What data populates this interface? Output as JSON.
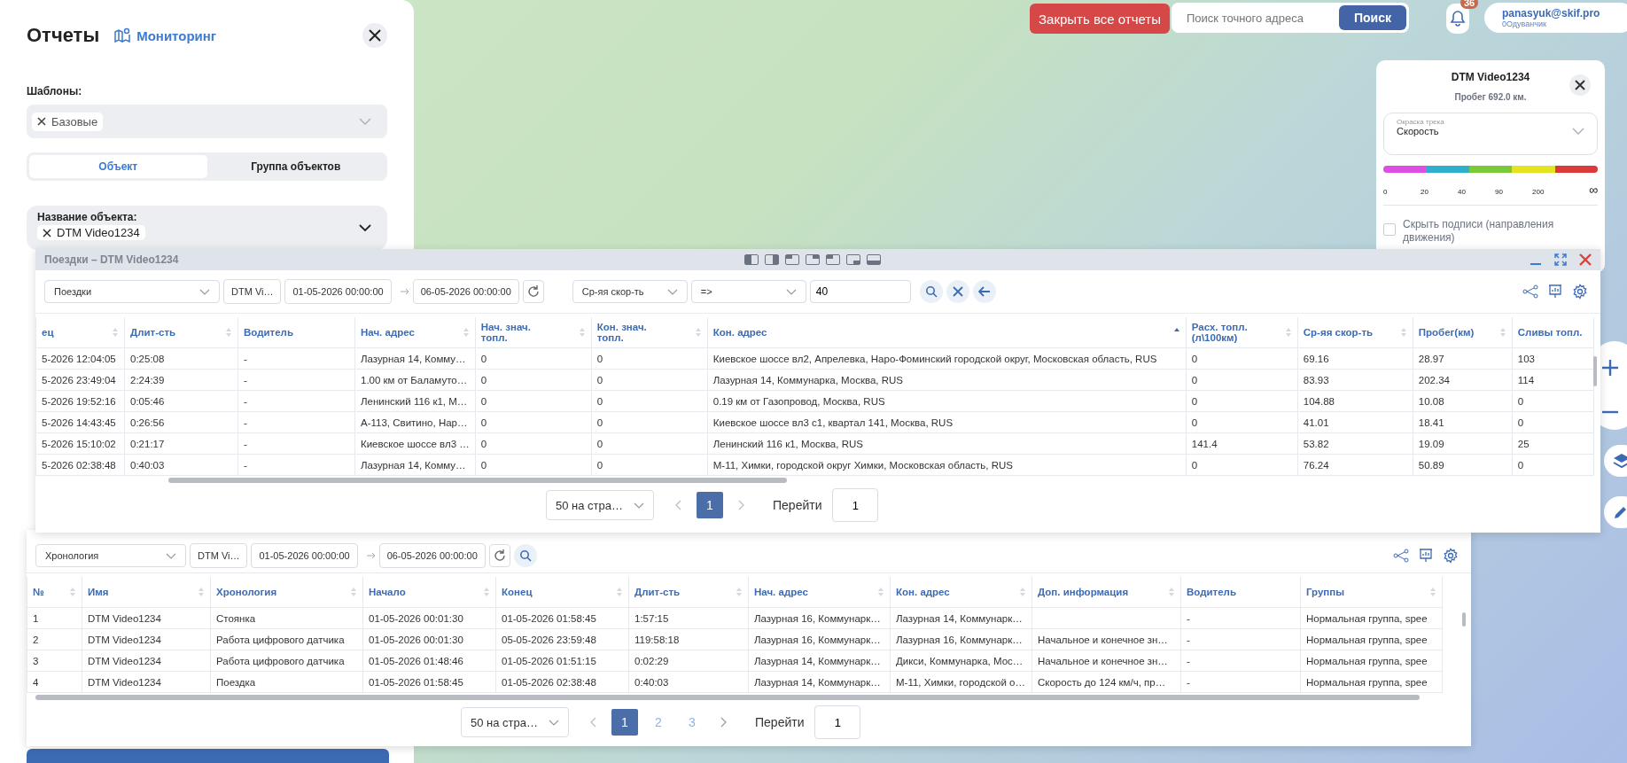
{
  "top_bar": {
    "close_all_button": "Закрыть все отчеты",
    "search": {
      "placeholder": "Поиск точного адреса",
      "button": "Поиск"
    },
    "notifications": {
      "count": "36"
    },
    "user": {
      "email": "panasyuk@skif.pro",
      "company": "0Одуванчик"
    }
  },
  "reports_panel": {
    "title": "Отчеты",
    "monitoring_link": "Мониторинг",
    "templates_label": "Шаблоны:",
    "templates": [
      {
        "label": "Базовые"
      }
    ],
    "tabs": [
      {
        "label": "Объект",
        "selected": true
      },
      {
        "label": "Группа объектов",
        "selected": false
      }
    ],
    "object_field": {
      "label": "Название объекта:",
      "chips": [
        {
          "label": "DTM Video1234"
        }
      ]
    }
  },
  "track_panel": {
    "title": "DTM Video1234",
    "mileage": "Пробег 692.0 км.",
    "coloring": {
      "label": "Окраска трека",
      "value": "Скорость"
    },
    "speed_scale": [
      {
        "color": "#dd4fe0"
      },
      {
        "color": "#2eb0cc"
      },
      {
        "color": "#7ac93a"
      },
      {
        "color": "#e3e31e"
      },
      {
        "color": "#dc3a3a"
      }
    ],
    "scale_labels": [
      "0",
      "20",
      "40",
      "90",
      "200",
      "∞"
    ],
    "hide_labels": {
      "label": "Скрыть подписи (направления движения)",
      "checked": false
    }
  },
  "trips_window": {
    "title": "Поездки – DTM Video1234",
    "toolbar": {
      "report_type": "Поездки",
      "object": "DTM Vi…",
      "date_from": "01-05-2026 00:00:00",
      "date_to": "06-05-2026 00:00:00",
      "filter_field": "Ср-яя скор-ть",
      "operator": "=>",
      "filter_value": "40"
    },
    "columns": [
      {
        "label": "ец",
        "sorted": false
      },
      {
        "label": "Длит-сть",
        "sorted": false
      },
      {
        "label": "Водитель"
      },
      {
        "label": "Нач. адрес",
        "sorted": false
      },
      {
        "label": "Нач. знач. топл.",
        "sorted": false
      },
      {
        "label": "Кон. знач. топл.",
        "sorted": false
      },
      {
        "label": "Кон. адрес",
        "sorted": true
      },
      {
        "label": "Расх. топл. (л\\100км)",
        "sorted": false
      },
      {
        "label": "Ср-яя скор-ть",
        "sorted": false
      },
      {
        "label": "Пробег(км)",
        "sorted": false
      },
      {
        "label": "Сливы топл."
      }
    ],
    "rows": [
      [
        "5-2026 12:04:05",
        "0:25:08",
        "-",
        "Лазурная 14, Комму…",
        "0",
        "0",
        "Киевское шоссе вл2, Апрелевка, Наро-Фоминский городской округ, Московская область, RUS",
        "0",
        "69.16",
        "28.97",
        "103"
      ],
      [
        "5-2026 23:49:04",
        "2:24:39",
        "-",
        "1.00 км от Баламуто…",
        "0",
        "0",
        "Лазурная 14, Коммунарка, Москва, RUS",
        "0",
        "83.93",
        "202.34",
        "114"
      ],
      [
        "5-2026 19:52:16",
        "0:05:46",
        "-",
        "Ленинский 116 к1, М…",
        "0",
        "0",
        "0.19 км от Газопровод, Москва, RUS",
        "0",
        "104.88",
        "10.08",
        "0"
      ],
      [
        "5-2026 14:43:45",
        "0:26:56",
        "-",
        "А-113, Свитино, Нар…",
        "0",
        "0",
        "Киевское шоссе вл3 с1, квартал 141, Москва, RUS",
        "0",
        "41.01",
        "18.41",
        "0"
      ],
      [
        "5-2026 15:10:02",
        "0:21:17",
        "-",
        "Киевское шоссе вл3 …",
        "0",
        "0",
        "Ленинский 116 к1, Москва, RUS",
        "141.4",
        "53.82",
        "19.09",
        "25"
      ],
      [
        "5-2026 02:38:48",
        "0:40:03",
        "-",
        "Лазурная 14, Комму…",
        "0",
        "0",
        "М-11, Химки, городской округ Химки, Московская область, RUS",
        "0",
        "76.24",
        "50.89",
        "0"
      ]
    ],
    "pagination": {
      "page_size": "50 на стра…",
      "pages": [
        {
          "label": "1",
          "selected": true
        }
      ],
      "goto_label": "Перейти",
      "goto_value": "1"
    }
  },
  "chronology_window": {
    "toolbar": {
      "report_type": "Хронология",
      "object": "DTM Vi…",
      "date_from": "01-05-2026 00:00:00",
      "date_to": "06-05-2026 00:00:00"
    },
    "columns": [
      {
        "label": "№",
        "sorted": false
      },
      {
        "label": "Имя",
        "sorted": false
      },
      {
        "label": "Хронология",
        "sorted": false
      },
      {
        "label": "Начало",
        "sorted": false
      },
      {
        "label": "Конец",
        "sorted": false
      },
      {
        "label": "Длит-сть",
        "sorted": false
      },
      {
        "label": "Нач. адрес",
        "sorted": false
      },
      {
        "label": "Кон. адрес",
        "sorted": false
      },
      {
        "label": "Доп. информация",
        "sorted": false
      },
      {
        "label": "Водитель"
      },
      {
        "label": "Группы",
        "sorted": false
      }
    ],
    "rows": [
      [
        "1",
        "DTM Video1234",
        "Стоянка",
        "01-05-2026 00:01:30",
        "01-05-2026 01:58:45",
        "1:57:15",
        "Лазурная 16, Коммунарк…",
        "Лазурная 14, Коммунарк…",
        null,
        "-",
        "Нормальная группа, spee"
      ],
      [
        "2",
        "DTM Video1234",
        "Работа цифрового датчика",
        "01-05-2026 00:01:30",
        "05-05-2026 23:59:48",
        "119:58:18",
        "Лазурная 16, Коммунарк…",
        "Лазурная 16, Коммунарк…",
        "Начальное и конечное зн…",
        "-",
        "Нормальная группа, spee"
      ],
      [
        "3",
        "DTM Video1234",
        "Работа цифрового датчика",
        "01-05-2026 01:48:46",
        "01-05-2026 01:51:15",
        "0:02:29",
        "Лазурная 14, Коммунарк…",
        "Дикси, Коммунарка, Мос…",
        "Начальное и конечное зн…",
        "-",
        "Нормальная группа, spee"
      ],
      [
        "4",
        "DTM Video1234",
        "Поездка",
        "01-05-2026 01:58:45",
        "01-05-2026 02:38:48",
        "0:40:03",
        "Лазурная 14, Коммунарк…",
        "М-11, Химки, городской о…",
        "Скорость до 124 км/ч, пр…",
        "-",
        "Нормальная группа, spee"
      ]
    ],
    "pagination": {
      "page_size": "50 на стра…",
      "pages": [
        {
          "label": "1",
          "selected": true
        },
        {
          "label": "2",
          "selected": false
        },
        {
          "label": "3",
          "selected": false
        }
      ],
      "goto_label": "Перейти",
      "goto_value": "1"
    }
  }
}
